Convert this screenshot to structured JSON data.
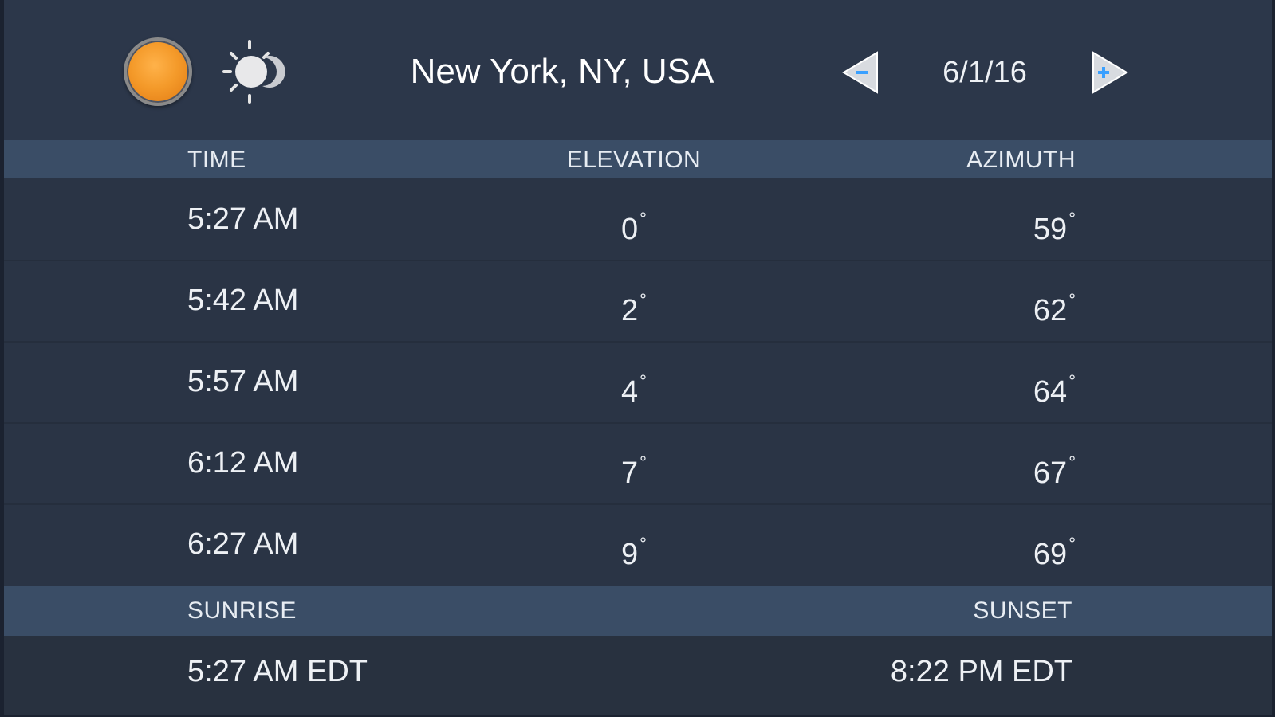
{
  "header": {
    "location": "New York, NY, USA",
    "date": "6/1/16",
    "sun_icon": "sun-icon",
    "moon_icon": "sun-moon-icon",
    "prev_icon": "left-arrow-minus-icon",
    "next_icon": "right-arrow-plus-icon"
  },
  "table": {
    "columns": [
      "TIME",
      "ELEVATION",
      "AZIMUTH"
    ],
    "rows": [
      {
        "time": "5:27 AM",
        "elevation": "0",
        "azimuth": "59"
      },
      {
        "time": "5:42 AM",
        "elevation": "2",
        "azimuth": "62"
      },
      {
        "time": "5:57 AM",
        "elevation": "4",
        "azimuth": "64"
      },
      {
        "time": "6:12 AM",
        "elevation": "7",
        "azimuth": "67"
      },
      {
        "time": "6:27 AM",
        "elevation": "9",
        "azimuth": "69"
      }
    ],
    "degree_symbol": "°"
  },
  "sun": {
    "sunrise_label": "SUNRISE",
    "sunset_label": "SUNSET",
    "sunrise": "5:27 AM EDT",
    "sunset": "8:22 PM EDT"
  },
  "colors": {
    "background": "#2a3445",
    "header_band": "#3a4d66",
    "sun_orange": "#f49a2a",
    "accent_blue": "#3aa0ff"
  }
}
